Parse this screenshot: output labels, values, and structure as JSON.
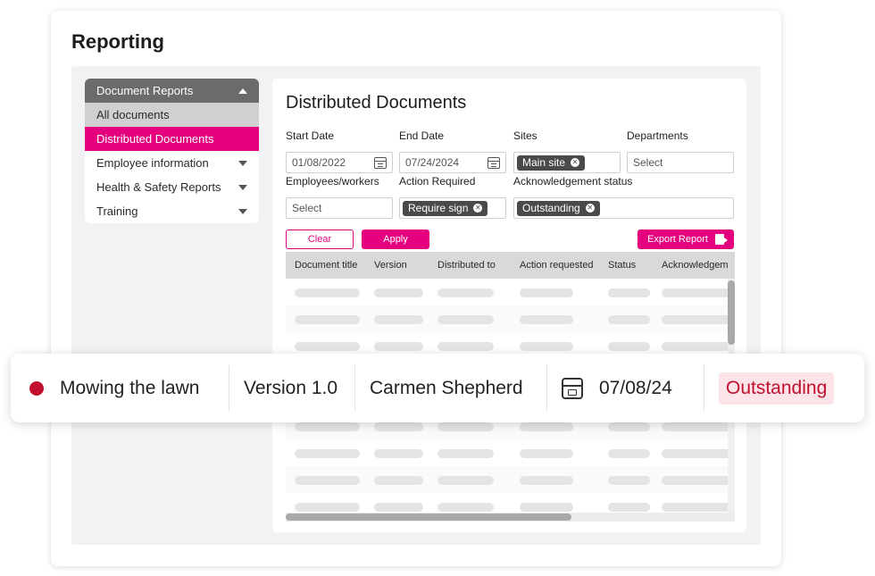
{
  "page": {
    "title": "Reporting"
  },
  "colors": {
    "accent": "#e5007d",
    "status_alert": "#c0102e",
    "header_grey": "#6b6b6d"
  },
  "sidebar": {
    "header": "Document Reports",
    "items": [
      {
        "label": "All documents"
      },
      {
        "label": "Distributed Documents"
      },
      {
        "label": "Employee information"
      },
      {
        "label": "Health & Safety Reports"
      },
      {
        "label": "Training"
      }
    ]
  },
  "main": {
    "title": "Distributed Documents",
    "filters": {
      "start_date": {
        "label": "Start Date",
        "value": "01/08/2022"
      },
      "end_date": {
        "label": "End Date",
        "value": "07/24/2024"
      },
      "sites": {
        "label": "Sites",
        "chip": "Main site"
      },
      "departments": {
        "label": "Departments",
        "placeholder": "Select"
      },
      "employees": {
        "label": "Employees/workers",
        "placeholder": "Select"
      },
      "action_required": {
        "label": "Action Required",
        "chip": "Require sign"
      },
      "ack_status": {
        "label": "Acknowledgement status",
        "chip": "Outstanding"
      }
    },
    "buttons": {
      "clear": "Clear",
      "apply": "Apply",
      "export": "Export Report"
    },
    "table": {
      "columns": [
        "Document title",
        "Version",
        "Distributed to",
        "Action requested",
        "Status",
        "Acknowledgem"
      ]
    }
  },
  "highlight_row": {
    "title": "Mowing the lawn",
    "version": "Version 1.0",
    "distributed_to": "Carmen Shepherd",
    "date": "07/08/24",
    "status": "Outstanding"
  },
  "icons": [
    "calendar-icon",
    "close-icon",
    "export-icon",
    "triangle-up-icon",
    "triangle-down-icon",
    "status-dot-icon"
  ]
}
